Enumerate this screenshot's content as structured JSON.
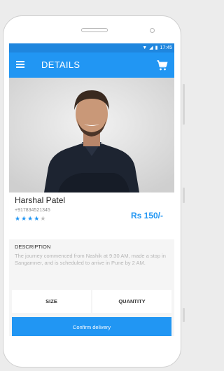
{
  "status_bar": {
    "time": "17:45",
    "icons": [
      "wifi-icon",
      "signal-icon",
      "battery-icon"
    ]
  },
  "app_bar": {
    "title": "DETAILS",
    "left_icon": "menu-icon",
    "right_icon": "cart-icon"
  },
  "profile": {
    "name": "Harshal Patel",
    "phone": "+917834521345",
    "price": "Rs 150/-",
    "rating": 4,
    "rating_max": 5
  },
  "description": {
    "title": "DESCRIPTION",
    "text": "The journey commenced from Nashik at 9:30 AM, made a stop in Sangamner, and is scheduled to arrive in Pune by 2 AM."
  },
  "options": {
    "size_label": "SIZE",
    "quantity_label": "QUANTITY"
  },
  "actions": {
    "confirm_label": "Confirm delivery"
  },
  "colors": {
    "primary": "#2196f3",
    "status_bar": "#1f86de"
  }
}
